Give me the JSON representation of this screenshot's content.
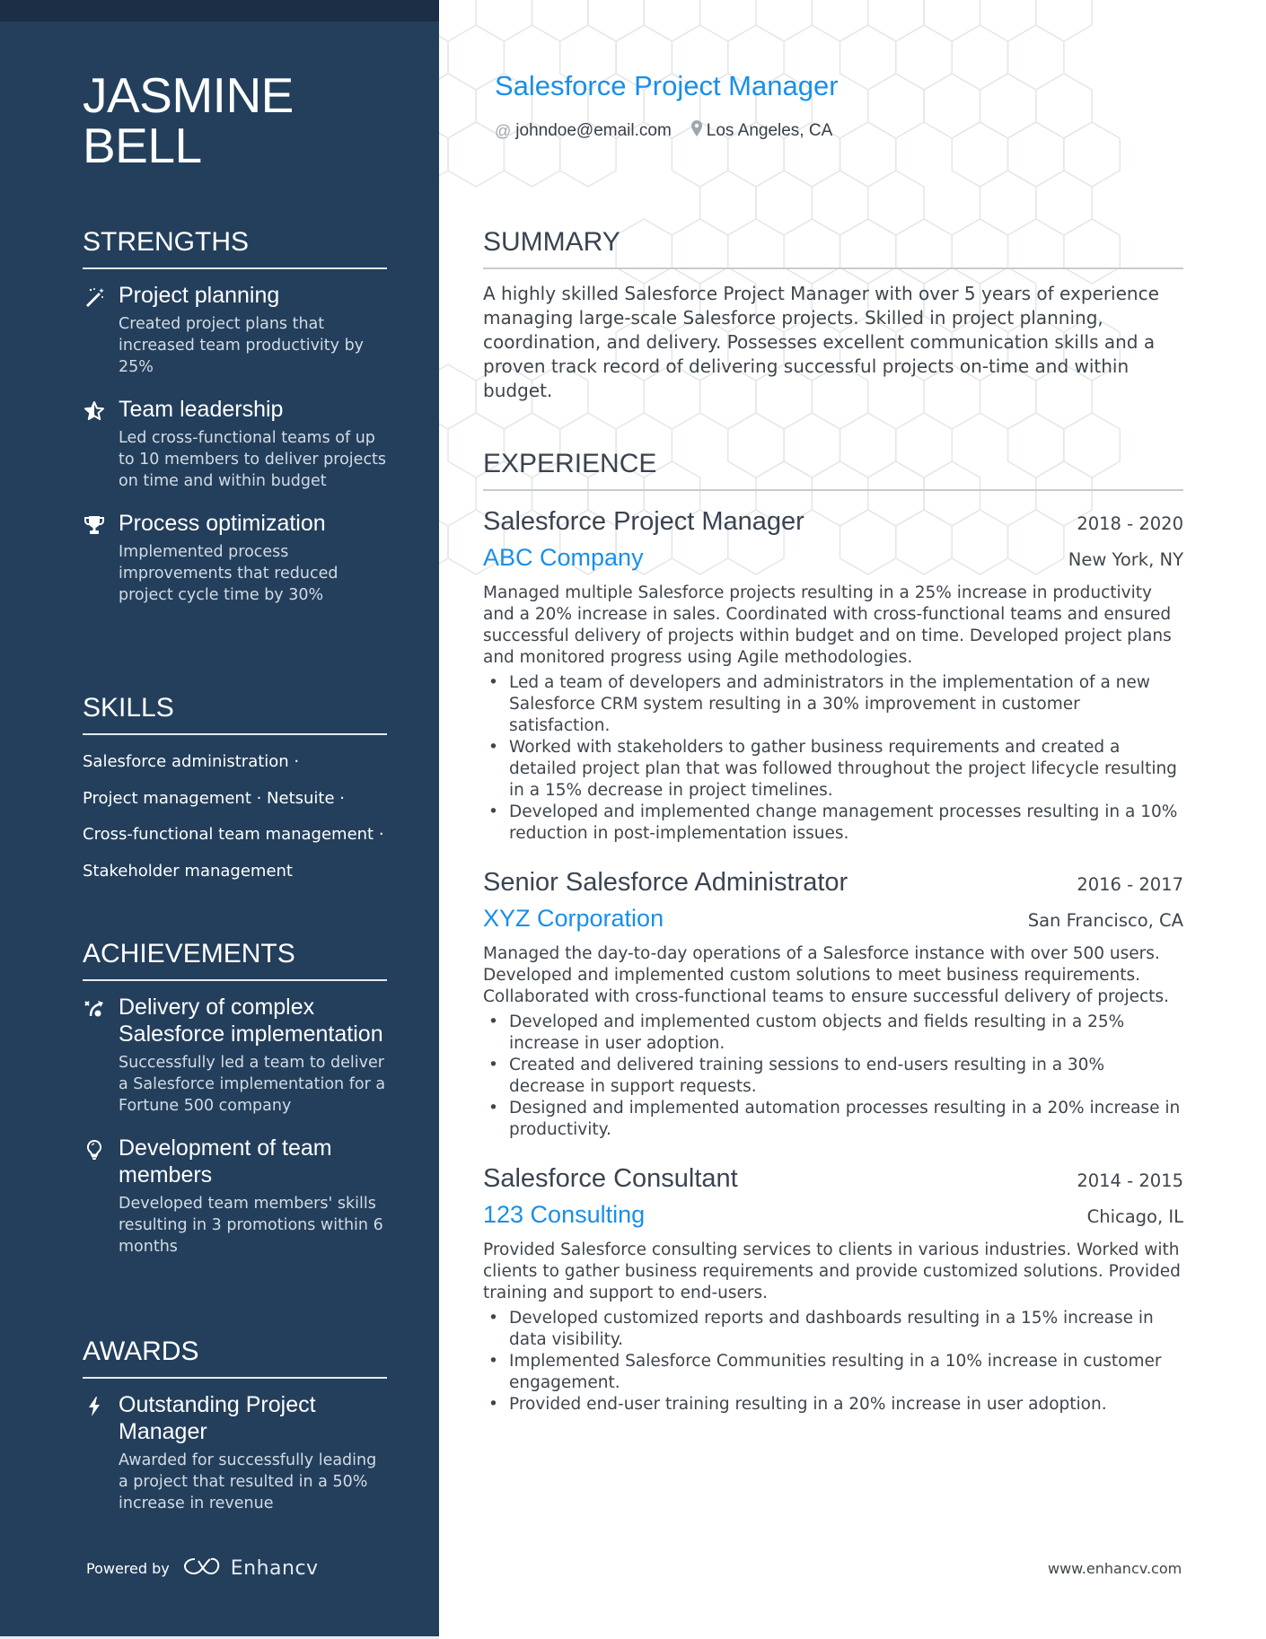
{
  "name": {
    "first": "JASMINE",
    "last": "BELL"
  },
  "title": "Salesforce Project Manager",
  "contact": {
    "email_icon": "at-icon",
    "email": "johndoe@email.com",
    "location_icon": "map-pin-icon",
    "location": "Los Angeles, CA"
  },
  "colors": {
    "sidebar": "#233f5c",
    "accent": "#1a8fe8",
    "text": "#3e454c"
  },
  "sidebar": {
    "strengths": {
      "heading": "STRENGTHS",
      "items": [
        {
          "icon": "magic-wand-icon",
          "title": "Project planning",
          "desc": "Created project plans that increased team productivity by 25%"
        },
        {
          "icon": "star-icon",
          "title": "Team leadership",
          "desc": "Led cross-functional teams of up to 10 members to deliver projects on time and within budget"
        },
        {
          "icon": "trophy-icon",
          "title": "Process optimization",
          "desc": "Implemented process improvements that reduced project cycle time by 30%"
        }
      ]
    },
    "skills": {
      "heading": "SKILLS",
      "lines": [
        "Salesforce administration ·",
        "Project management · Netsuite ·",
        "Cross-functional team management ·",
        "Stakeholder management"
      ]
    },
    "achievements": {
      "heading": "ACHIEVEMENTS",
      "items": [
        {
          "icon": "strategy-icon",
          "title": "Delivery of complex Salesforce implementation",
          "desc": "Successfully led a team to deliver a Salesforce implementation for a Fortune 500 company"
        },
        {
          "icon": "lightbulb-icon",
          "title": "Development of team members",
          "desc": "Developed team members' skills resulting in 3 promotions within 6 months"
        }
      ]
    },
    "awards": {
      "heading": "AWARDS",
      "items": [
        {
          "icon": "lightning-icon",
          "title": "Outstanding Project Manager",
          "desc": "Awarded for successfully leading a project that resulted in a 50% increase in revenue"
        }
      ]
    },
    "powered_by": {
      "label": "Powered by",
      "brand": "Enhancv",
      "brand_icon": "enhancv-logo-icon"
    }
  },
  "summary": {
    "heading": "SUMMARY",
    "text": "A highly skilled Salesforce Project Manager with over 5 years of experience managing large-scale Salesforce projects. Skilled in project planning, coordination, and delivery. Possesses excellent communication skills and a proven track record of delivering successful projects on-time and within budget."
  },
  "experience": {
    "heading": "EXPERIENCE",
    "jobs": [
      {
        "role": "Salesforce Project Manager",
        "dates": "2018 - 2020",
        "company": "ABC Company",
        "location": "New York, NY",
        "desc": "Managed multiple Salesforce projects resulting in a 25% increase in productivity and a 20% increase in sales. Coordinated with cross-functional teams and ensured successful delivery of projects within budget and on time. Developed project plans and monitored progress using Agile methodologies.",
        "bullets": [
          "Led a team of developers and administrators in the implementation of a new Salesforce CRM system resulting in a 30% improvement in customer satisfaction.",
          "Worked with stakeholders to gather business requirements and created a detailed project plan that was followed throughout the project lifecycle resulting in a 15% decrease in project timelines.",
          "Developed and implemented change management processes resulting in a 10% reduction in post-implementation issues."
        ]
      },
      {
        "role": "Senior Salesforce Administrator",
        "dates": "2016 - 2017",
        "company": "XYZ Corporation",
        "location": "San Francisco, CA",
        "desc": "Managed the day-to-day operations of a Salesforce instance with over 500 users. Developed and implemented custom solutions to meet business requirements. Collaborated with cross-functional teams to ensure successful delivery of projects.",
        "bullets": [
          "Developed and implemented custom objects and fields resulting in a 25% increase in user adoption.",
          "Created and delivered training sessions to end-users resulting in a 30% decrease in support requests.",
          "Designed and implemented automation processes resulting in a 20% increase in productivity."
        ]
      },
      {
        "role": "Salesforce Consultant",
        "dates": "2014 - 2015",
        "company": "123 Consulting",
        "location": "Chicago, IL",
        "desc": "Provided Salesforce consulting services to clients in various industries. Worked with clients to gather business requirements and provide customized solutions. Provided training and support to end-users.",
        "bullets": [
          "Developed customized reports and dashboards resulting in a 15% increase in data visibility.",
          "Implemented Salesforce Communities resulting in a 10% increase in customer engagement.",
          "Provided end-user training resulting in a 20% increase in user adoption."
        ]
      }
    ]
  },
  "footer": {
    "url": "www.enhancv.com"
  }
}
